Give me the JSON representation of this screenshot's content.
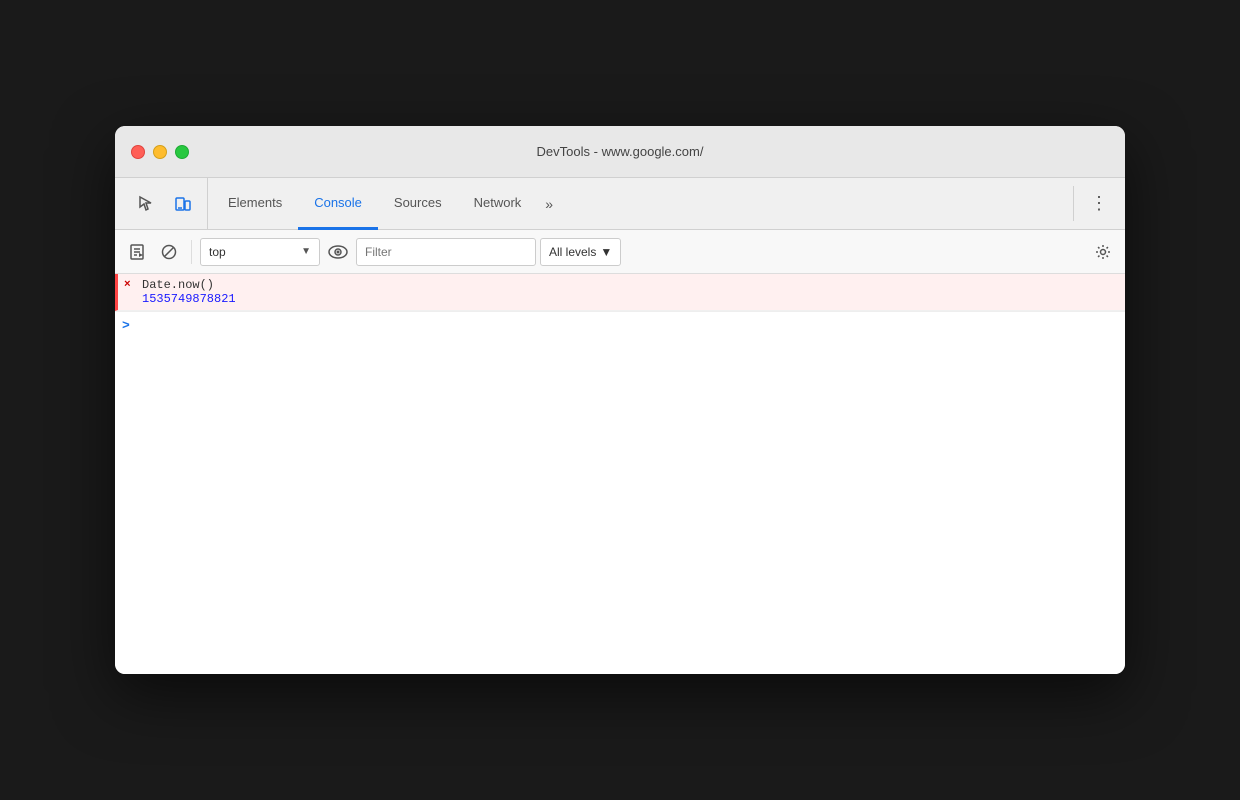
{
  "window": {
    "title": "DevTools - www.google.com/"
  },
  "traffic_lights": {
    "close_label": "close",
    "minimize_label": "minimize",
    "maximize_label": "maximize"
  },
  "toolbar": {
    "icon_inspect_tooltip": "inspect element",
    "icon_device_tooltip": "device toolbar",
    "tabs": [
      {
        "id": "elements",
        "label": "Elements",
        "active": false
      },
      {
        "id": "console",
        "label": "Console",
        "active": true
      },
      {
        "id": "sources",
        "label": "Sources",
        "active": false
      },
      {
        "id": "network",
        "label": "Network",
        "active": false
      }
    ],
    "more_label": "»",
    "menu_label": "⋮"
  },
  "console_toolbar": {
    "run_label": "▶",
    "clear_label": "🚫",
    "context": {
      "value": "top",
      "placeholder": "top"
    },
    "filter_placeholder": "Filter",
    "levels_label": "All levels",
    "gear_label": "⚙"
  },
  "console_entries": [
    {
      "type": "command",
      "icon": "×",
      "command": "Date.now()",
      "result": "1535749878821"
    }
  ],
  "console_input": {
    "chevron": ">",
    "placeholder": ""
  },
  "colors": {
    "active_tab": "#1a73e8",
    "result_value": "#1a1aff",
    "error_icon": "#cc0000",
    "input_chevron": "#1a73e8"
  }
}
